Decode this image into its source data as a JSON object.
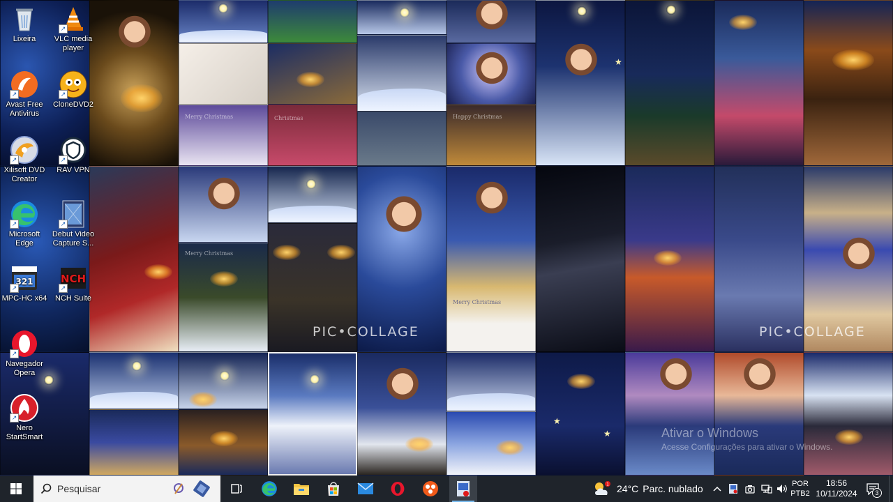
{
  "desktop": {
    "icons": [
      {
        "label": "Lixeira",
        "icon": "recycle-bin-icon"
      },
      {
        "label": "VLC media player",
        "icon": "vlc-icon"
      },
      {
        "label": "Avast Free Antivirus",
        "icon": "avast-icon"
      },
      {
        "label": "CloneDVD2",
        "icon": "clonedvd-icon"
      },
      {
        "label": "Xilisoft DVD Creator",
        "icon": "xilisoft-icon"
      },
      {
        "label": "RAV VPN",
        "icon": "vpn-icon"
      },
      {
        "label": "Microsoft Edge",
        "icon": "edge-icon"
      },
      {
        "label": "Debut Video Capture S...",
        "icon": "debut-icon"
      },
      {
        "label": "MPC-HC x64",
        "icon": "mpc-hc-icon"
      },
      {
        "label": "NCH Suite",
        "icon": "nch-icon"
      },
      {
        "label": "Navegador Opera",
        "icon": "opera-icon"
      },
      {
        "label": "Nero StartSmart",
        "icon": "nero-icon"
      }
    ]
  },
  "wallpaper": {
    "watermarks": [
      "PIC•COLLAGE",
      "PIC•COLLAGE"
    ],
    "tile_captions": [
      "Merry Christmas",
      "Christmas",
      "Happy Christmas",
      "Merry Christmas",
      "Merry Christmas"
    ],
    "activate_windows": {
      "title": "Ativar o Windows",
      "subtitle": "Acesse Configurações para ativar o Windows."
    }
  },
  "taskbar": {
    "search_placeholder": "Pesquisar",
    "weather": {
      "temp": "24°C",
      "condition": "Parc. nublado"
    },
    "language": {
      "line1": "POR",
      "line2": "PTB2"
    },
    "clock": {
      "time": "18:56",
      "date": "10/11/2024"
    },
    "notification_count": "3"
  },
  "colors": {
    "taskbar_bg": "#1f242b",
    "accent": "#76b9ed"
  }
}
